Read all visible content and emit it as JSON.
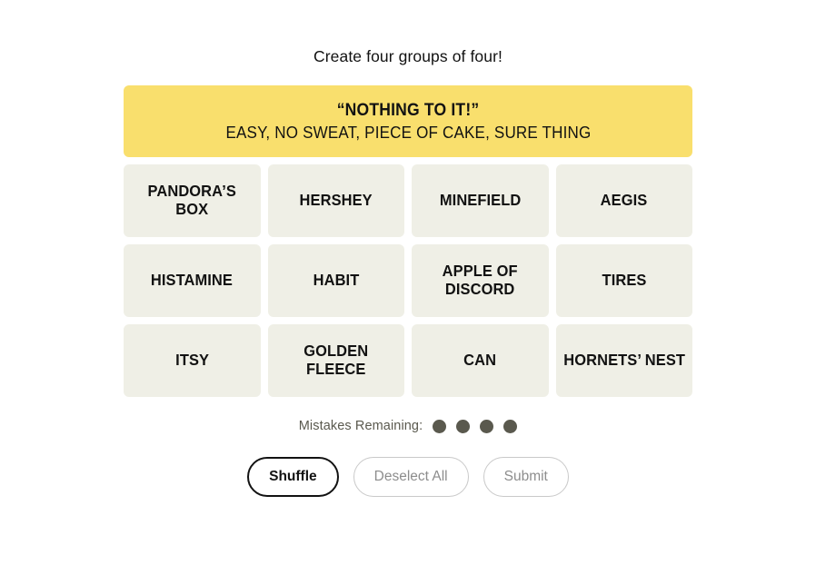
{
  "app": {
    "title_instruction": "Create four groups of four!"
  },
  "colors": {
    "page_background": "#ffffff",
    "tile_background": "#efefe6",
    "text": "#121212",
    "yellow_category": "#f9df6d",
    "mistake_dot": "#5a594e",
    "muted_button_border": "#c9c9c9",
    "muted_button_text": "#8d8d8d"
  },
  "solved_categories": [
    {
      "title": "“NOTHING TO IT!”",
      "members": "EASY, NO SWEAT, PIECE OF CAKE, SURE THING",
      "color": "#f9df6d",
      "difficulty": "yellow"
    }
  ],
  "grid": {
    "columns": 4,
    "rows": [
      [
        {
          "label": "PANDORA’S BOX",
          "selected": false
        },
        {
          "label": "HERSHEY",
          "selected": false
        },
        {
          "label": "MINEFIELD",
          "selected": false
        },
        {
          "label": "AEGIS",
          "selected": false
        }
      ],
      [
        {
          "label": "HISTAMINE",
          "selected": false
        },
        {
          "label": "HABIT",
          "selected": false
        },
        {
          "label": "APPLE OF\nDISCORD",
          "selected": false
        },
        {
          "label": "TIRES",
          "selected": false
        }
      ],
      [
        {
          "label": "ITSY",
          "selected": false
        },
        {
          "label": "GOLDEN\nFLEECE",
          "selected": false
        },
        {
          "label": "CAN",
          "selected": false
        },
        {
          "label": "HORNETS’ NEST",
          "selected": false
        }
      ]
    ]
  },
  "mistakes": {
    "label": "Mistakes Remaining:",
    "remaining": 4,
    "dots": [
      1,
      2,
      3,
      4
    ]
  },
  "buttons": {
    "shuffle": {
      "label": "Shuffle",
      "state": "active"
    },
    "deselect_all": {
      "label": "Deselect All",
      "state": "muted"
    },
    "submit": {
      "label": "Submit",
      "state": "muted"
    }
  }
}
